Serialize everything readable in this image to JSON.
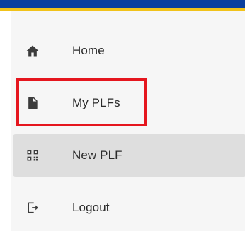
{
  "colors": {
    "header_blue": "#0a3f9e",
    "header_yellow": "#f1c21a",
    "highlight_red": "#e5161e",
    "active_bg": "#dedede"
  },
  "nav": {
    "items": [
      {
        "label": "Home",
        "icon": "home-icon"
      },
      {
        "label": "My PLFs",
        "icon": "document-icon"
      },
      {
        "label": "New PLF",
        "icon": "qr-code-icon"
      },
      {
        "label": "Logout",
        "icon": "logout-icon"
      }
    ],
    "active_index": 2,
    "highlighted_index": 1
  }
}
